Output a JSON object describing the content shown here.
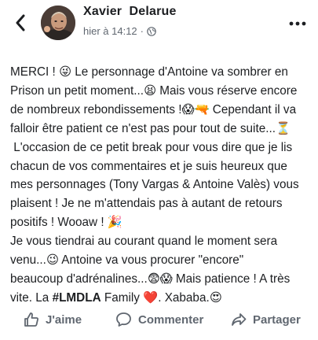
{
  "header": {
    "author": "Xavier  Delarue",
    "time": "hier à 14:12",
    "separator": "·"
  },
  "post": {
    "lines": [
      "MERCI ! 😜 Le personnage d'Antoine va sombrer en",
      "Prison un petit moment...😫 Mais vous réserve encore",
      "de nombreux rebondissements !😱🔫 Cependant il va",
      "falloir être patient ce n'est pas pour tout de suite...⏳",
      " L'occasion de ce petit break pour vous dire que je lis",
      "chacun de vos commentaires et je suis heureux que",
      "mes personnages (Tony Vargas & Antoine Valès) vous",
      "plaisent ! Je ne m'attendais pas à autant de retours",
      "positifs ! Wooaw ! 🎉",
      "Je vous tiendrai au courant quand le moment sera",
      "venu...😉 Antoine va vous procurer \"encore\"",
      "beaucoup d'adrénalines...😨😱 Mais patience ! A très"
    ],
    "last_line_prefix": "vite. La ",
    "hashtag": "#LMDLA",
    "last_line_suffix": " Family ❤️. Xababa.😍"
  },
  "actions": {
    "like": "J'aime",
    "comment": "Commenter",
    "share": "Partager"
  },
  "colors": {
    "text": "#1c1e21",
    "secondary": "#606770",
    "background": "#ffffff"
  }
}
